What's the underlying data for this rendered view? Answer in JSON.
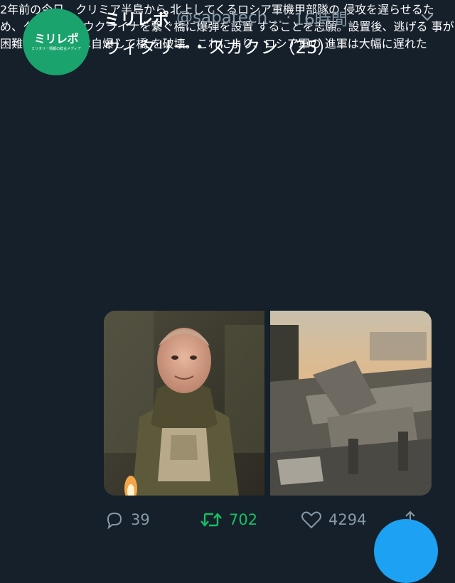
{
  "account": {
    "display_name": "ミリレポ",
    "handle": "@sabatech...",
    "dot": "·",
    "time": "16時間",
    "avatar_logo": "ミリレポ",
    "avatar_tagline": "ミリタリー情報の総合メディア"
  },
  "tweet": {
    "headline": "ヴィタリー・スカクン（25）",
    "flag_colors": [
      "#2a6bd6",
      "#f5cf2d"
    ],
    "body": "2年前の今日、クリミア半島から\n北上してくるロシア軍機甲部隊の\n侵攻を遅らせるため、クリミアと\nウクライナを繋ぐ橋に爆弾を設置\nすることを志願。設置後、逃げる\n事が困難と悟った彼は自爆して橋\nを破壊。これにより、ロシア軍の\n進軍は大幅に遅れた"
  },
  "actions": {
    "reply_count": "39",
    "retweet_count": "702",
    "like_count": "4294"
  },
  "colors": {
    "background": "#15202b",
    "muted_text": "#8899a6",
    "retweet_active": "#17bf63",
    "avatar_bg": "#1aa36c",
    "accent": "#1da1f2"
  }
}
